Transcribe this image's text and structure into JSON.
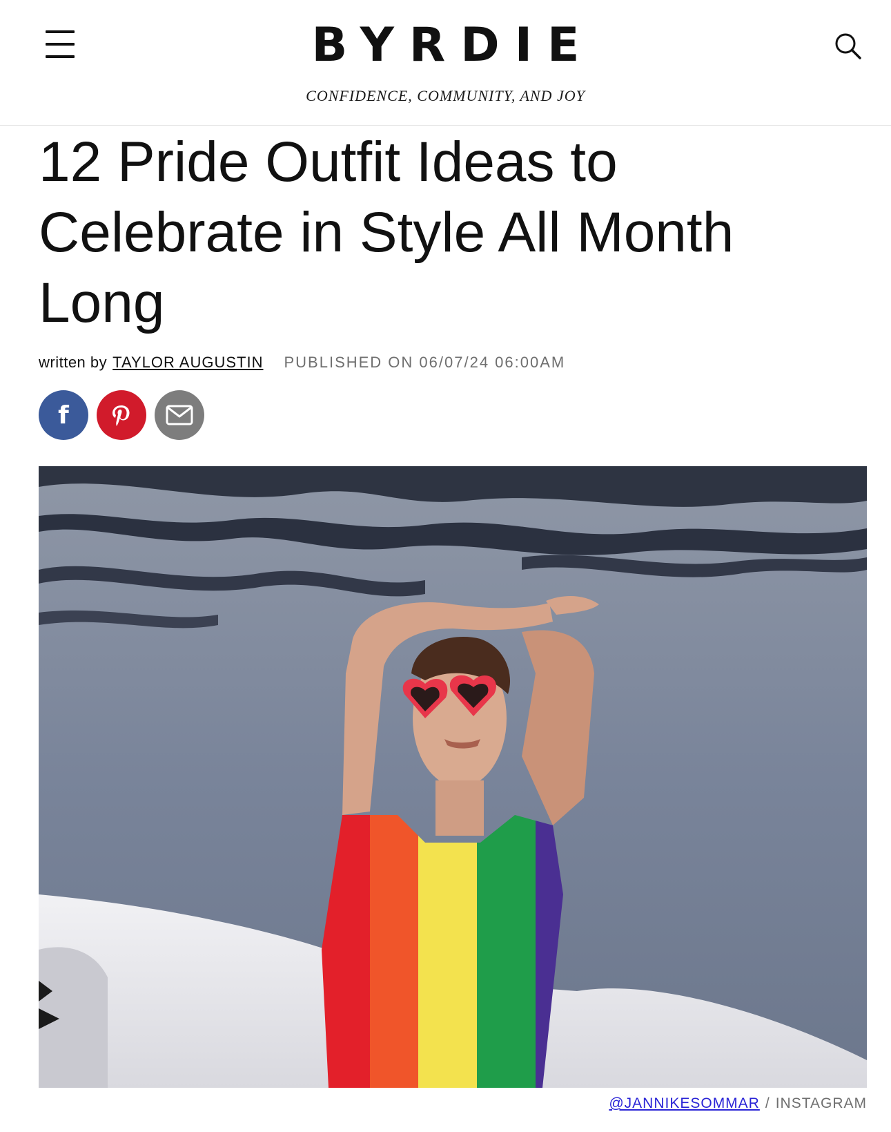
{
  "header": {
    "menu_icon": "hamburger-menu-icon",
    "logo": "BYRDIE",
    "tagline": "CONFIDENCE, COMMUNITY, AND JOY",
    "search_icon": "search-icon"
  },
  "article": {
    "title": "12 Pride Outfit Ideas to Celebrate in Style All Month Long",
    "byline_prefix": "written by",
    "author": "TAYLOR AUGUSTIN",
    "published": "PUBLISHED ON 06/07/24 06:00AM"
  },
  "share": {
    "facebook_icon": "facebook-icon",
    "pinterest_icon": "pinterest-icon",
    "email_icon": "email-icon",
    "facebook_color": "#3b5a9a",
    "pinterest_color": "#d11b2b",
    "email_color": "#7d7d7d"
  },
  "hero_image": {
    "credit_handle": "@JANNIKESOMMAR",
    "credit_separator": "/",
    "credit_source": "INSTAGRAM"
  },
  "colors": {
    "link": "#2a24d6",
    "meta_text": "#6f6f6f"
  }
}
